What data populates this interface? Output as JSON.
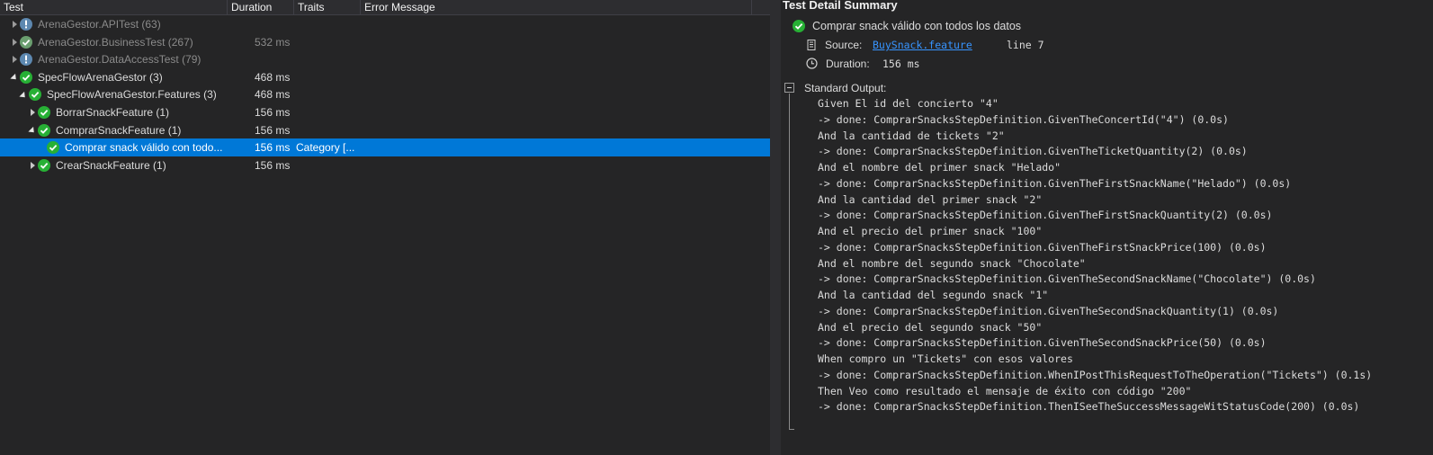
{
  "header": {
    "columns": [
      "Test",
      "Duration",
      "Traits",
      "Error Message"
    ]
  },
  "tree": [
    {
      "label": "ArenaGestor.APITest (63)",
      "duration": "",
      "traits": "",
      "status": "info",
      "dim": true,
      "expanded": false,
      "level": 0
    },
    {
      "label": "ArenaGestor.BusinessTest (267)",
      "duration": "532 ms",
      "traits": "",
      "status": "pass",
      "dim": true,
      "expanded": false,
      "level": 0
    },
    {
      "label": "ArenaGestor.DataAccessTest (79)",
      "duration": "",
      "traits": "",
      "status": "info",
      "dim": true,
      "expanded": false,
      "level": 0
    },
    {
      "label": "SpecFlowArenaGestor (3)",
      "duration": "468 ms",
      "traits": "",
      "status": "pass",
      "dim": false,
      "expanded": true,
      "level": 0
    },
    {
      "label": "SpecFlowArenaGestor.Features (3)",
      "duration": "468 ms",
      "traits": "",
      "status": "pass",
      "dim": false,
      "expanded": true,
      "level": 1
    },
    {
      "label": "BorrarSnackFeature (1)",
      "duration": "156 ms",
      "traits": "",
      "status": "pass",
      "dim": false,
      "expanded": false,
      "level": 2
    },
    {
      "label": "ComprarSnackFeature (1)",
      "duration": "156 ms",
      "traits": "",
      "status": "pass",
      "dim": false,
      "expanded": true,
      "level": 2
    },
    {
      "label": "Comprar snack válido con todo...",
      "duration": "156 ms",
      "traits": "Category [...",
      "status": "pass",
      "dim": false,
      "expanded": null,
      "level": 3,
      "selected": true
    },
    {
      "label": "CrearSnackFeature (1)",
      "duration": "156 ms",
      "traits": "",
      "status": "pass",
      "dim": false,
      "expanded": false,
      "level": 2
    }
  ],
  "detail": {
    "title": "Test Detail Summary",
    "test_name": "Comprar snack válido con todos los datos",
    "source_label": "Source:",
    "source_file": "BuySnack.feature",
    "source_line": "line 7",
    "duration_label": "Duration:",
    "duration_value": "156 ms",
    "output_label": "Standard Output:",
    "output_lines": [
      "Given El id del concierto \"4\"",
      "-> done: ComprarSnacksStepDefinition.GivenTheConcertId(\"4\") (0.0s)",
      "And la cantidad de tickets \"2\"",
      "-> done: ComprarSnacksStepDefinition.GivenTheTicketQuantity(2) (0.0s)",
      "And el nombre del primer snack \"Helado\"",
      "-> done: ComprarSnacksStepDefinition.GivenTheFirstSnackName(\"Helado\") (0.0s)",
      "And la cantidad del primer snack \"2\"",
      "-> done: ComprarSnacksStepDefinition.GivenTheFirstSnackQuantity(2) (0.0s)",
      "And el precio del primer snack \"100\"",
      "-> done: ComprarSnacksStepDefinition.GivenTheFirstSnackPrice(100) (0.0s)",
      "And el nombre del segundo snack \"Chocolate\"",
      "-> done: ComprarSnacksStepDefinition.GivenTheSecondSnackName(\"Chocolate\") (0.0s)",
      "And la cantidad del segundo snack \"1\"",
      "-> done: ComprarSnacksStepDefinition.GivenTheSecondSnackQuantity(1) (0.0s)",
      "And el precio del segundo snack \"50\"",
      "-> done: ComprarSnacksStepDefinition.GivenTheSecondSnackPrice(50) (0.0s)",
      "When compro un \"Tickets\" con esos valores",
      "-> done: ComprarSnacksStepDefinition.WhenIPostThisRequestToTheOperation(\"Tickets\") (0.1s)",
      "Then Veo como resultado el mensaje de éxito con código \"200\"",
      "-> done: ComprarSnacksStepDefinition.ThenISeeTheSuccessMessageWitStatusCode(200) (0.0s)"
    ]
  },
  "colors": {
    "background": "#252526",
    "selected_row": "#0078d7",
    "pass_green": "#27b035",
    "info_blue": "#3c8fd9",
    "link": "#3794ff"
  }
}
